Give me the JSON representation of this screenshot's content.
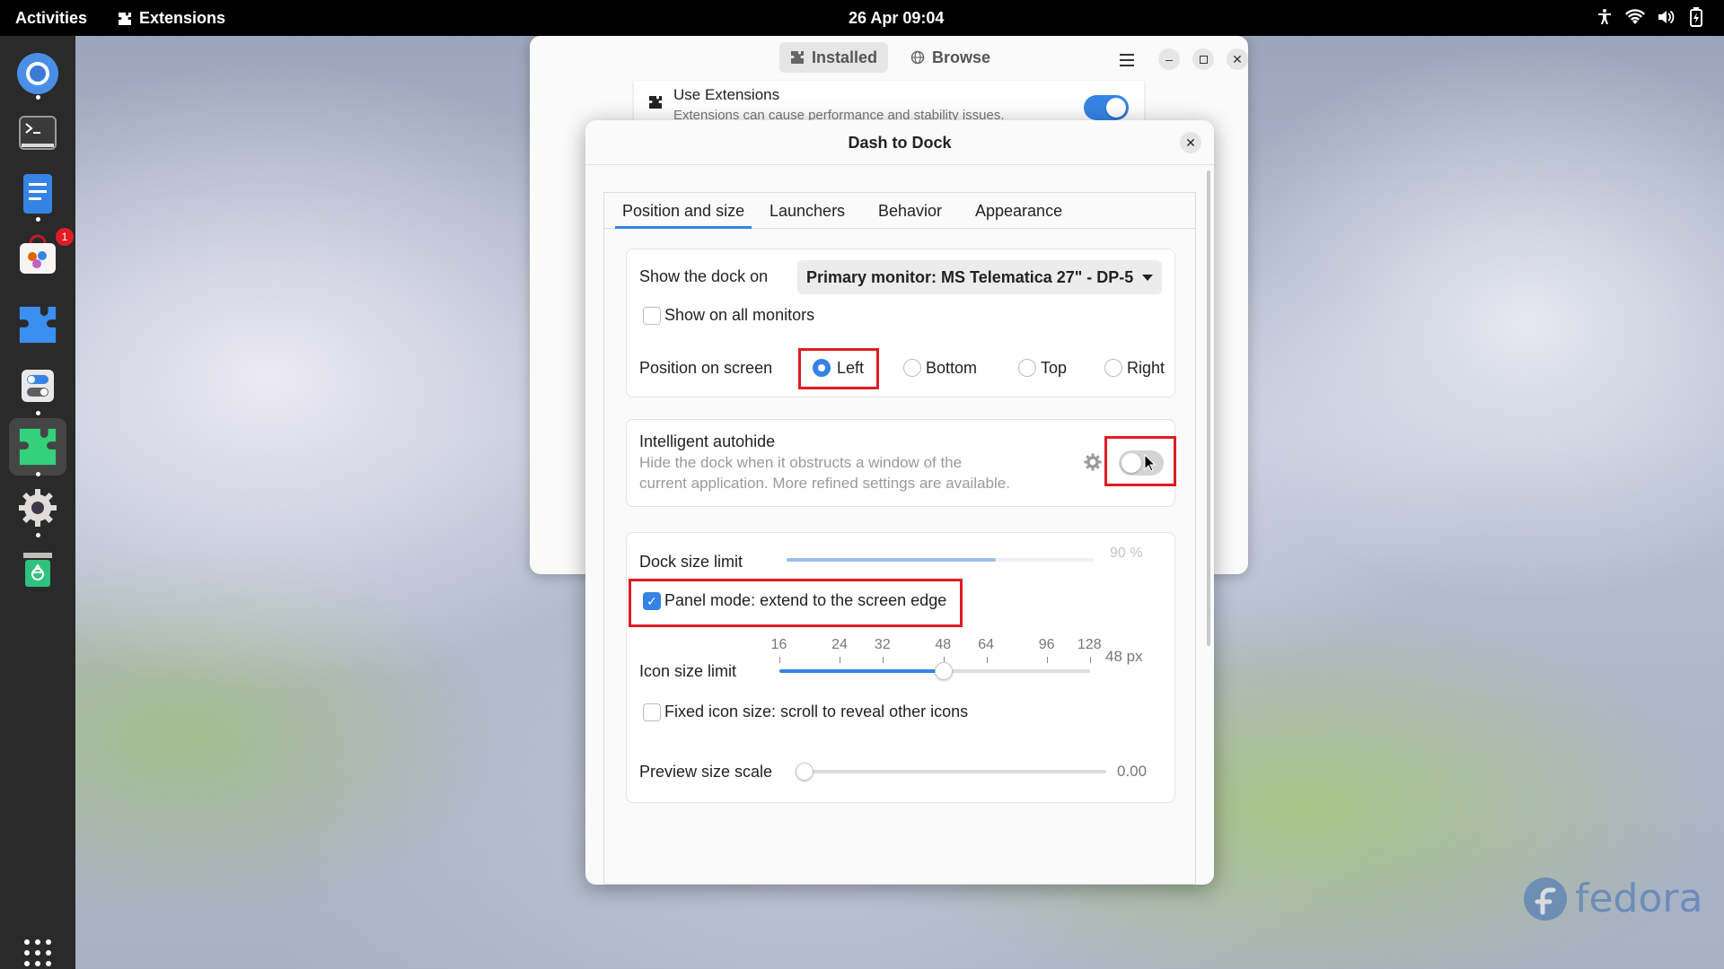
{
  "topbar": {
    "activities": "Activities",
    "app_menu": "Extensions",
    "clock": "26 Apr  09:04",
    "tray_icons": [
      "accessibility-icon",
      "wifi-icon",
      "volume-icon",
      "battery-icon"
    ]
  },
  "dock": {
    "items": [
      {
        "name": "chromium-browser",
        "running": true
      },
      {
        "name": "terminal",
        "running": false
      },
      {
        "name": "text-editor",
        "running": true
      },
      {
        "name": "software",
        "running": false,
        "badge": "1"
      },
      {
        "name": "extension-manager",
        "running": false
      },
      {
        "name": "tweaks",
        "running": true
      },
      {
        "name": "extensions",
        "running": true,
        "active": true
      },
      {
        "name": "settings",
        "running": true
      },
      {
        "name": "trash",
        "running": false
      }
    ],
    "app_grid": "show-apps"
  },
  "extensions_window": {
    "tabs": [
      {
        "label": "Installed",
        "icon": "puzzle-icon",
        "active": true
      },
      {
        "label": "Browse",
        "icon": "globe-icon",
        "active": false
      }
    ],
    "use_extensions": {
      "title": "Use Extensions",
      "subtitle": "Extensions can cause performance and stability issues.",
      "enabled": true
    }
  },
  "dialog": {
    "title": "Dash to Dock",
    "tabs": [
      {
        "label": "Position and size",
        "active": true
      },
      {
        "label": "Launchers",
        "active": false
      },
      {
        "label": "Behavior",
        "active": false
      },
      {
        "label": "Appearance",
        "active": false
      }
    ],
    "show_dock_on": {
      "label": "Show the dock on",
      "value": "Primary monitor: MS Telematica 27\" - DP-5"
    },
    "show_all_monitors": {
      "label": "Show on all monitors",
      "checked": false
    },
    "position": {
      "label": "Position on screen",
      "options": [
        "Left",
        "Bottom",
        "Top",
        "Right"
      ],
      "selected": "Left"
    },
    "autohide": {
      "title": "Intelligent autohide",
      "line1": "Hide the dock when it obstructs a window of the",
      "line2": "current application. More refined settings are available.",
      "enabled": false
    },
    "dock_size": {
      "label": "Dock size limit",
      "value_text": "90 %",
      "value": 0.9
    },
    "panel_mode": {
      "label": "Panel mode: extend to the screen edge",
      "checked": true
    },
    "icon_size": {
      "label": "Icon size limit",
      "marks": [
        "16",
        "24",
        "32",
        "48",
        "64",
        "96",
        "128"
      ],
      "value_text": "48 px",
      "value": 48
    },
    "fixed_icon": {
      "label": "Fixed icon size: scroll to reveal other icons",
      "checked": false
    },
    "preview_scale": {
      "label": "Preview size scale",
      "value_text": "0.00",
      "value": 0
    }
  },
  "watermark": "fedora",
  "colors": {
    "accent": "#3584e4",
    "highlight": "#e01b24"
  }
}
